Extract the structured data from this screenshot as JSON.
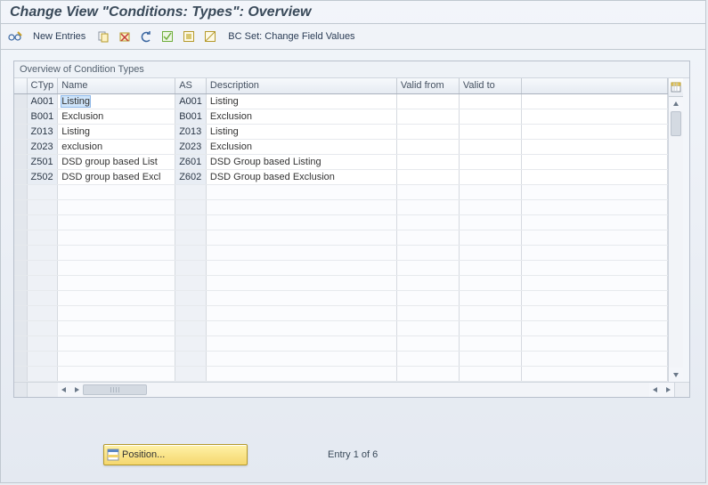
{
  "header": {
    "title": "Change View \"Conditions: Types\": Overview"
  },
  "toolbar": {
    "new_entries": "New Entries",
    "bc_set": "BC Set: Change Field Values"
  },
  "panel": {
    "title": "Overview of Condition Types"
  },
  "table": {
    "columns": {
      "ctyp": "CTyp",
      "name": "Name",
      "as": "AS",
      "desc": "Description",
      "valid_from": "Valid from",
      "valid_to": "Valid to"
    },
    "rows": [
      {
        "ctyp": "A001",
        "name": "Listing",
        "as": "A001",
        "desc": "Listing",
        "valid_from": "",
        "valid_to": ""
      },
      {
        "ctyp": "B001",
        "name": "Exclusion",
        "as": "B001",
        "desc": "Exclusion",
        "valid_from": "",
        "valid_to": ""
      },
      {
        "ctyp": "Z013",
        "name": "Listing",
        "as": "Z013",
        "desc": "Listing",
        "valid_from": "",
        "valid_to": ""
      },
      {
        "ctyp": "Z023",
        "name": "exclusion",
        "as": "Z023",
        "desc": "Exclusion",
        "valid_from": "",
        "valid_to": ""
      },
      {
        "ctyp": "Z501",
        "name": "DSD group based List",
        "as": "Z601",
        "desc": "DSD Group based Listing",
        "valid_from": "",
        "valid_to": ""
      },
      {
        "ctyp": "Z502",
        "name": "DSD group based Excl",
        "as": "Z602",
        "desc": "DSD Group based Exclusion",
        "valid_from": "",
        "valid_to": ""
      }
    ],
    "empty_rows": 13,
    "selected": {
      "row": 0,
      "col": "name"
    }
  },
  "footer": {
    "position_label": "Position...",
    "entry_text": "Entry 1 of 6"
  }
}
